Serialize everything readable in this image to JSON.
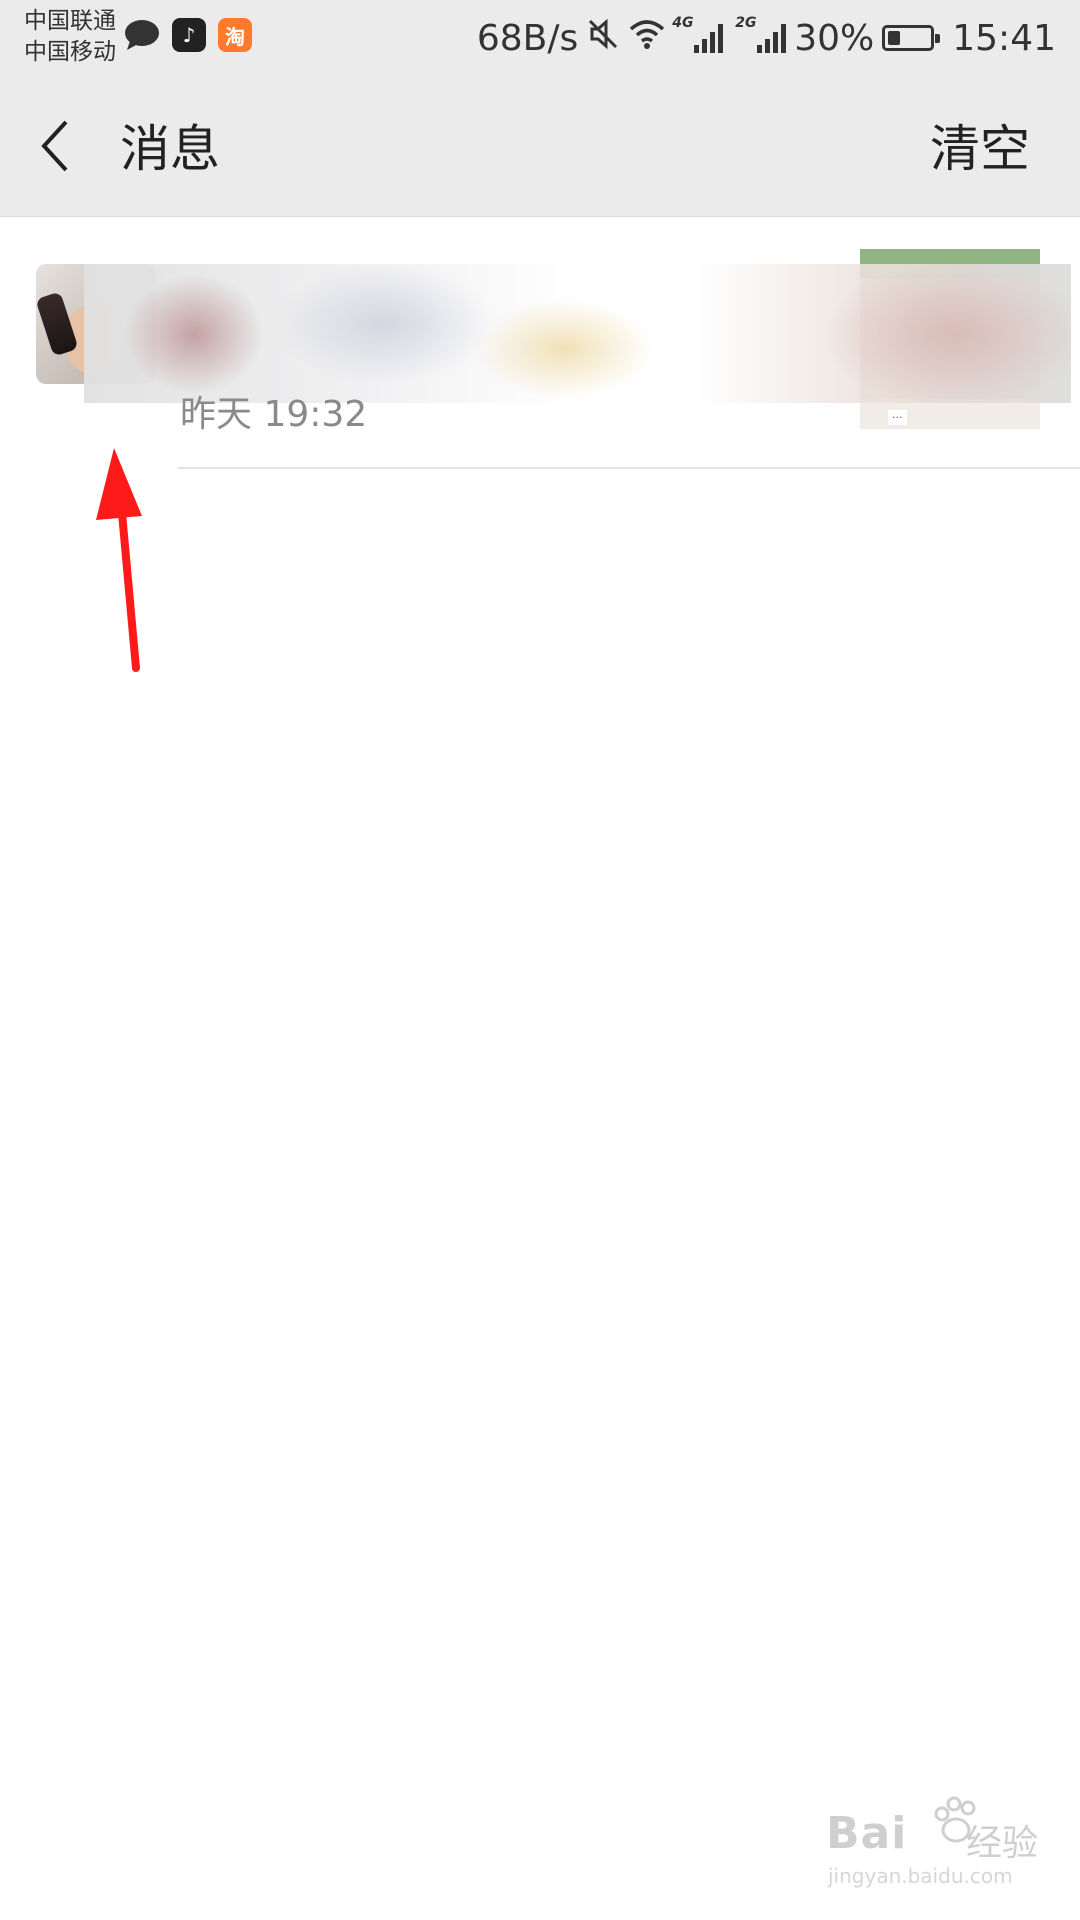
{
  "status_bar": {
    "carrier_1": "中国联通",
    "carrier_2": "中国移动",
    "notification_icons": [
      "chat-bubble-icon",
      "tiktok-icon",
      "taobao-icon"
    ],
    "taobao_label": "淘",
    "tiktok_label": "♪",
    "net_speed": "68B/s",
    "network_1": "4G",
    "network_2": "2G",
    "battery": "30%",
    "battery_level": 0.3,
    "time": "15:41"
  },
  "header": {
    "title": "消息",
    "clear_label": "清空"
  },
  "messages": [
    {
      "time": "昨天 19:32",
      "content_blurred": true
    }
  ],
  "annotation": {
    "arrow_color": "#ff1a1a"
  },
  "watermark": {
    "brand": "Bai",
    "brand_suffix": "经验",
    "url": "jingyan.baidu.com"
  }
}
